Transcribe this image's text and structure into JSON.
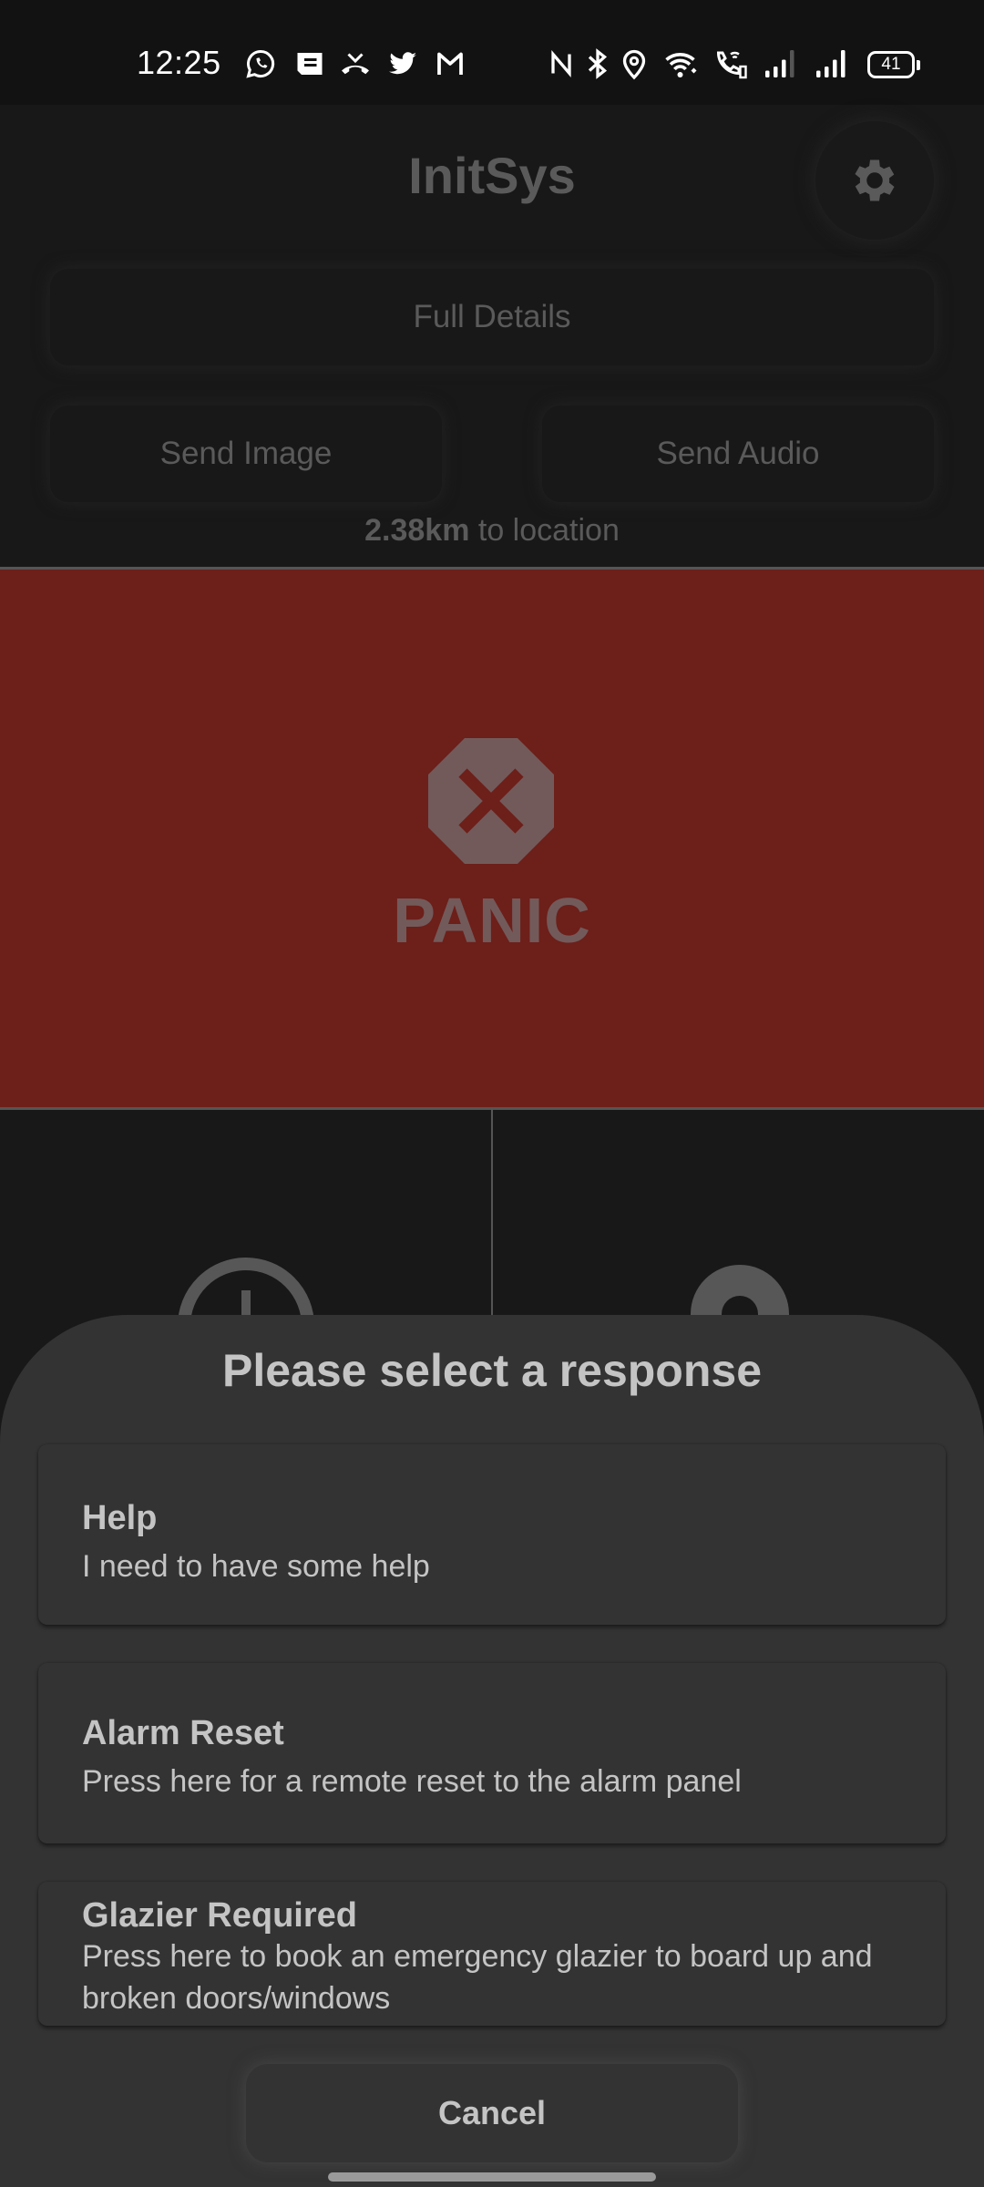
{
  "status_bar": {
    "time": "12:25",
    "notification_icons": [
      "whatsapp-icon",
      "message-icon",
      "missed-call-icon",
      "twitter-icon",
      "gmail-icon"
    ],
    "system_icons": [
      "nfc-icon",
      "bluetooth-icon",
      "location-icon",
      "wifi-icon",
      "wifi-calling-icon",
      "signal-icon",
      "signal-icon"
    ],
    "battery": "41"
  },
  "header": {
    "title": "InitSys",
    "settings_icon": "gear-icon"
  },
  "actions": {
    "full_details": "Full Details",
    "send_image": "Send Image",
    "send_audio": "Send Audio"
  },
  "distance": {
    "value": "2.38km",
    "suffix": " to location"
  },
  "panic": {
    "label": "PANIC",
    "icon": "stop-x-icon",
    "color": "#6d1f1a"
  },
  "sheet": {
    "title": "Please select a response",
    "options": [
      {
        "title": "Help",
        "description": "I need to have some help"
      },
      {
        "title": "Alarm Reset",
        "description": "Press here for a remote reset to the alarm panel"
      },
      {
        "title": "Glazier Required",
        "description": "Press here to book an emergency glazier to board up and broken doors/windows"
      }
    ],
    "cancel": "Cancel"
  }
}
